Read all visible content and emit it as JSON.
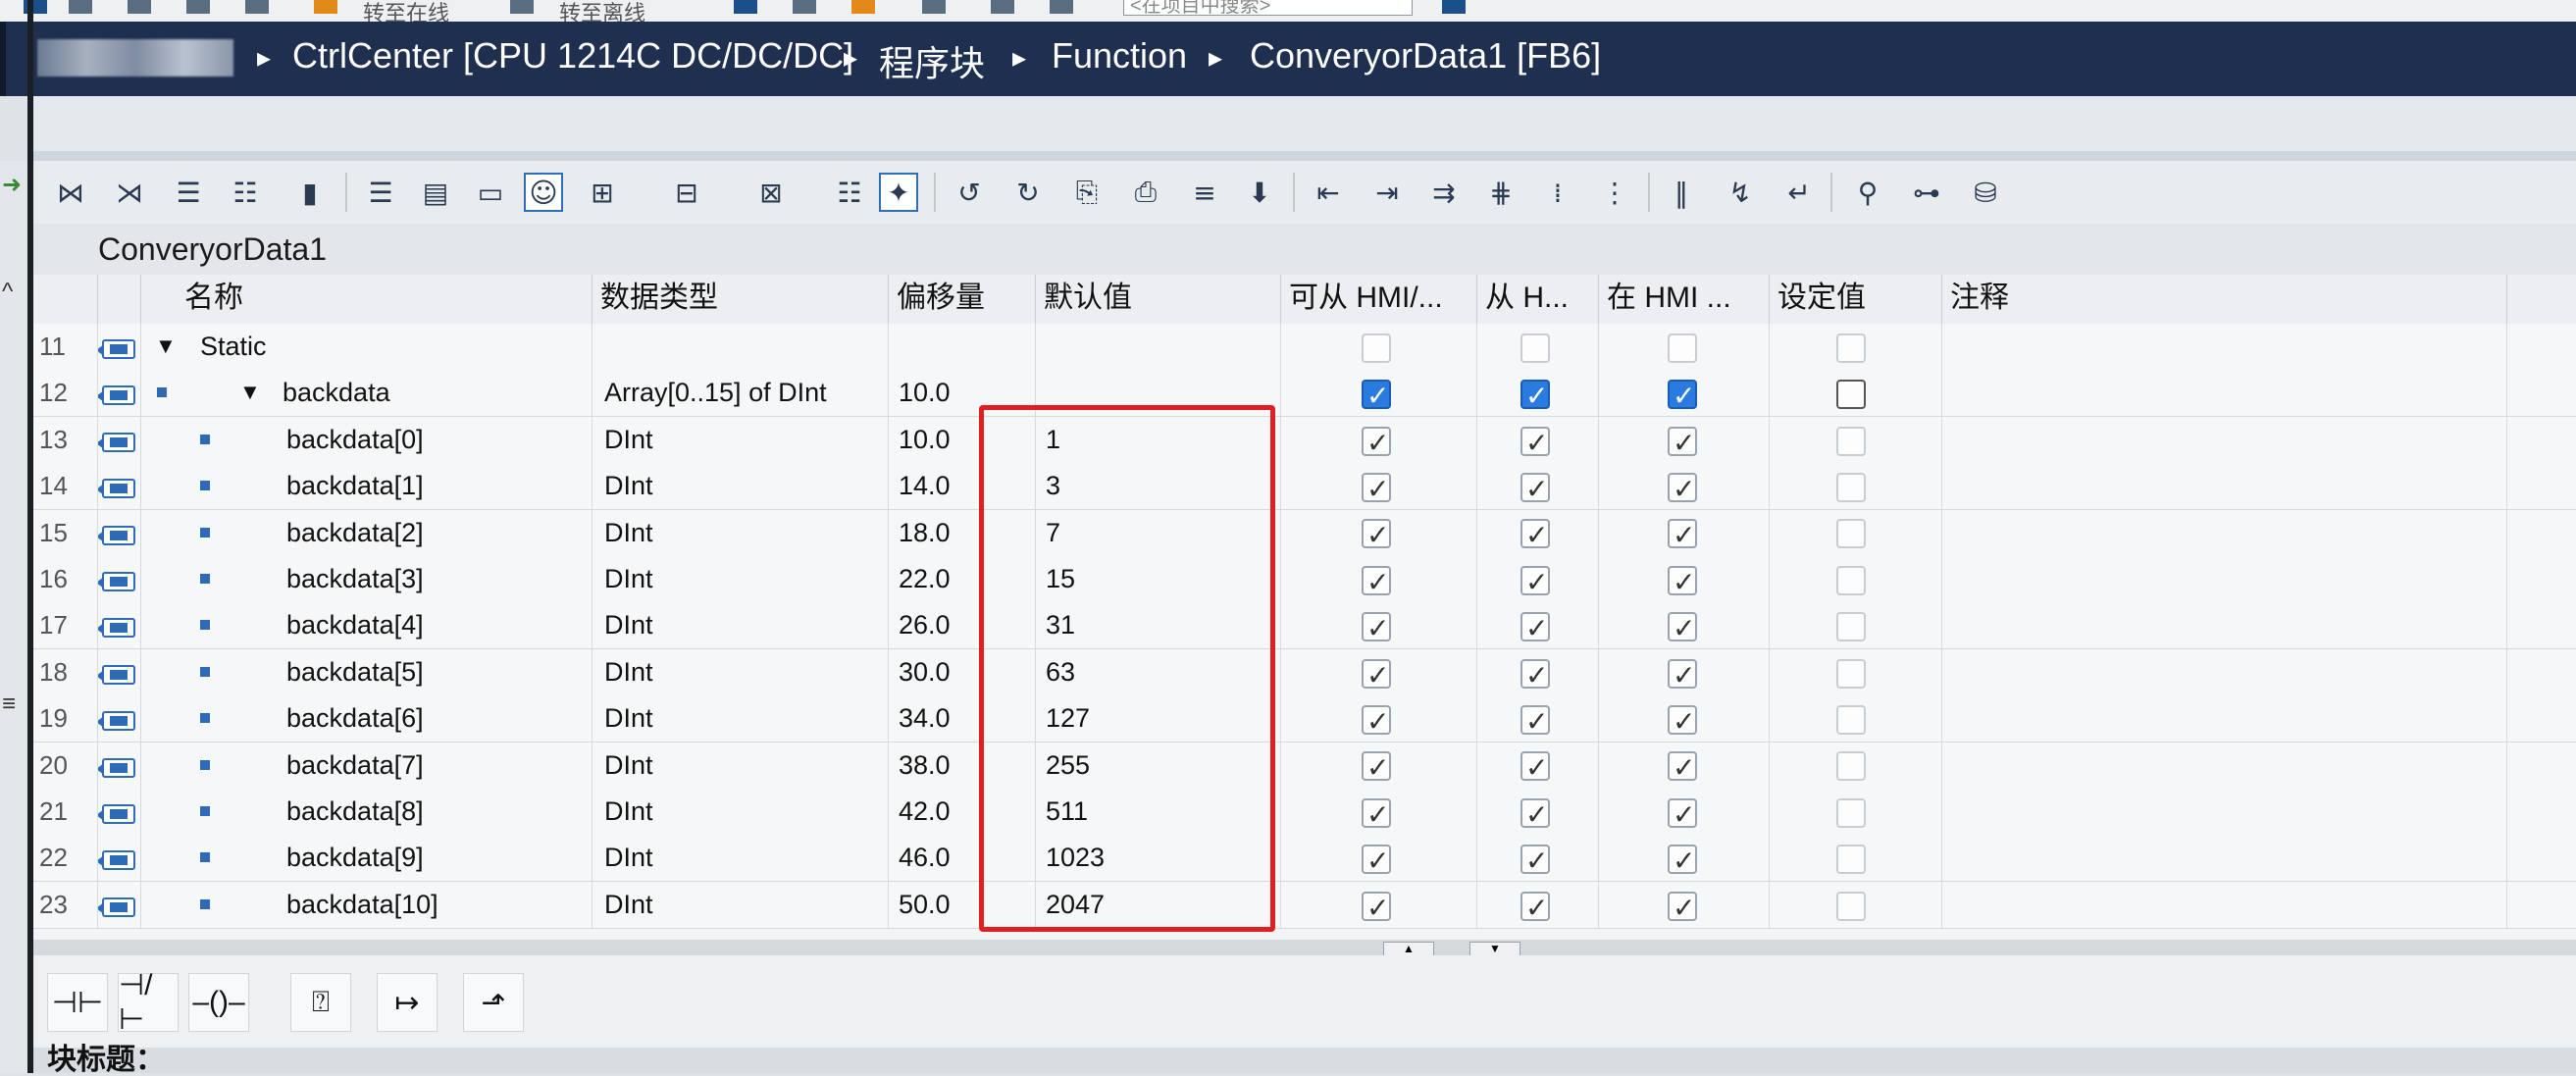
{
  "top_toolbar": {
    "search_placeholder": "<在项目中搜索>",
    "item1": "转至在线",
    "item2": "转至离线"
  },
  "breadcrumb": {
    "items": [
      "CtrlCenter [CPU 1214C DC/DC/DC]",
      "程序块",
      "Function",
      "ConveryorData1 [FB6]"
    ]
  },
  "block": {
    "title": "ConveryorData1"
  },
  "columns": {
    "name": "名称",
    "datatype": "数据类型",
    "offset": "偏移量",
    "default": "默认值",
    "hmi_access": "可从 HMI/...",
    "hmi_from": "从 H...",
    "hmi_in": "在 HMI ...",
    "setpoint": "设定值",
    "comment": "注释"
  },
  "rows": [
    {
      "num": "11",
      "name": "Static",
      "type": "",
      "offset": "",
      "default": ""
    },
    {
      "num": "12",
      "name": "backdata",
      "type": "Array[0..15] of DInt",
      "offset": "10.0",
      "default": ""
    },
    {
      "num": "13",
      "name": "backdata[0]",
      "type": "DInt",
      "offset": "10.0",
      "default": "1"
    },
    {
      "num": "14",
      "name": "backdata[1]",
      "type": "DInt",
      "offset": "14.0",
      "default": "3"
    },
    {
      "num": "15",
      "name": "backdata[2]",
      "type": "DInt",
      "offset": "18.0",
      "default": "7"
    },
    {
      "num": "16",
      "name": "backdata[3]",
      "type": "DInt",
      "offset": "22.0",
      "default": "15"
    },
    {
      "num": "17",
      "name": "backdata[4]",
      "type": "DInt",
      "offset": "26.0",
      "default": "31"
    },
    {
      "num": "18",
      "name": "backdata[5]",
      "type": "DInt",
      "offset": "30.0",
      "default": "63"
    },
    {
      "num": "19",
      "name": "backdata[6]",
      "type": "DInt",
      "offset": "34.0",
      "default": "127"
    },
    {
      "num": "20",
      "name": "backdata[7]",
      "type": "DInt",
      "offset": "38.0",
      "default": "255"
    },
    {
      "num": "21",
      "name": "backdata[8]",
      "type": "DInt",
      "offset": "42.0",
      "default": "511"
    },
    {
      "num": "22",
      "name": "backdata[9]",
      "type": "DInt",
      "offset": "46.0",
      "default": "1023"
    },
    {
      "num": "23",
      "name": "backdata[10]",
      "type": "DInt",
      "offset": "50.0",
      "default": "2047"
    }
  ],
  "bottom": {
    "network_title": "块标题："
  },
  "colors": {
    "highlight": "#e02020",
    "breadcrumb_bg": "#1e2f4f",
    "checkbox_blue": "#2a7be0"
  }
}
